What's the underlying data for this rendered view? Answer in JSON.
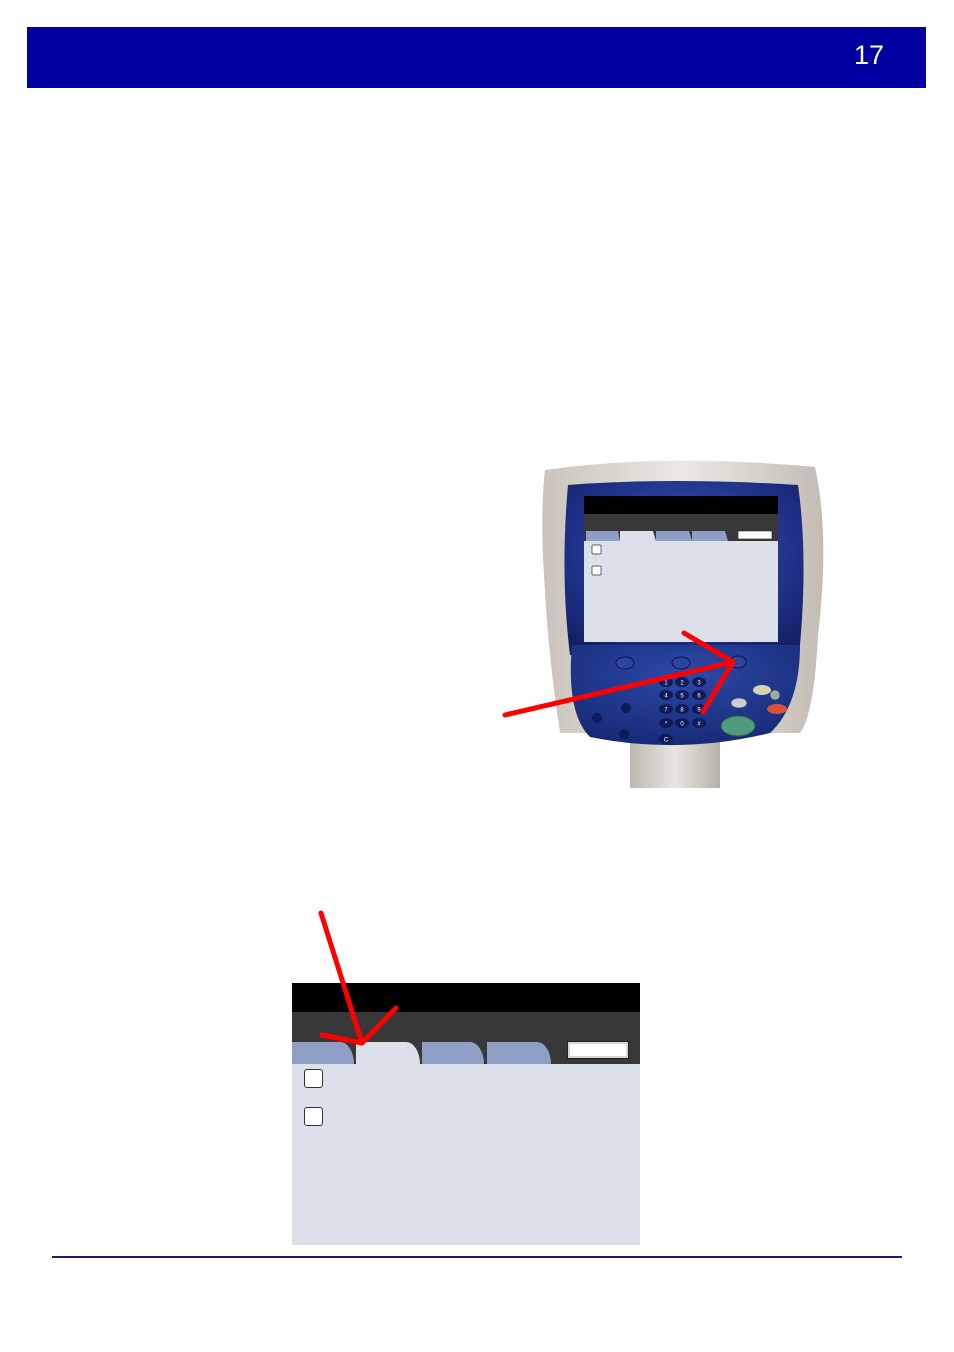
{
  "header": {
    "page_number": "17"
  },
  "colors": {
    "header_blue": "#0000a0",
    "annotation_red": "#ff0000",
    "panel_blue": "#1f3a8a",
    "screen_bg": "#dbe0ea",
    "tab_blue": "#8f9ec3"
  },
  "device_panel": {
    "tabs": 4,
    "selected_tab_index": 1,
    "checkboxes": 2,
    "keypad_keys": [
      "1",
      "2",
      "3",
      "4",
      "5",
      "6",
      "7",
      "8",
      "9",
      "*",
      "0",
      "#",
      "C"
    ]
  },
  "zoom_screen": {
    "tabs": 4,
    "selected_tab_index": 1,
    "checkboxes": 2
  }
}
